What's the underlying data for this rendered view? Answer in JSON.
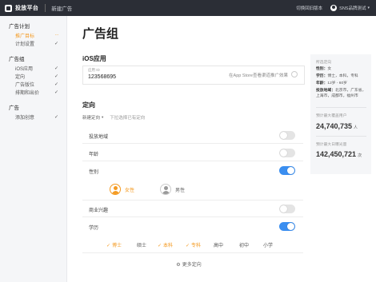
{
  "topbar": {
    "app_name": "投放平台",
    "current_page": "新建广告",
    "help_link": "切换回旧版本",
    "user_name": "SNS品牌测试"
  },
  "sidebar": {
    "groups": [
      {
        "title": "广告计划",
        "items": [
          {
            "label": "推广目标",
            "mark": "···",
            "active": true
          },
          {
            "label": "计划设置",
            "mark": "✓",
            "active": false
          }
        ]
      },
      {
        "title": "广告组",
        "items": [
          {
            "label": "iOS应用",
            "mark": "✓",
            "active": false
          },
          {
            "label": "定向",
            "mark": "✓",
            "active": false
          },
          {
            "label": "广告版位",
            "mark": "✓",
            "active": false
          },
          {
            "label": "排期和出价",
            "mark": "✓",
            "active": false
          }
        ]
      },
      {
        "title": "广告",
        "items": [
          {
            "label": "添加创意",
            "mark": "✓",
            "active": false
          }
        ]
      }
    ]
  },
  "main": {
    "page_title": "广告组",
    "ios_section_title": "iOS应用",
    "app_id_label": "应用 ID",
    "app_id_value": "123568695",
    "app_store_link": "在App Store查看渠道推广效果",
    "targeting_title": "定向",
    "targeting_select": "新建定向",
    "targeting_hint": "下拉选择已有定向",
    "rows": {
      "location": {
        "label": "投放地域",
        "on": false
      },
      "age": {
        "label": "年龄",
        "on": false
      },
      "gender": {
        "label": "性别",
        "on": true
      },
      "interest": {
        "label": "商业兴趣",
        "on": false
      },
      "education": {
        "label": "学历",
        "on": true
      }
    },
    "gender_options": {
      "female": "女性",
      "male": "男性"
    },
    "education_options": {
      "phd": "博士",
      "master": "硕士",
      "bachelor": "本科",
      "associate": "专科",
      "high_school": "高中",
      "middle_school": "初中",
      "primary": "小学"
    },
    "more_targeting": "更多定向"
  },
  "summary": {
    "label_selected": "所选定向",
    "gender_line_key": "性别：",
    "gender_line_val": "女",
    "education_line_key": "学历：",
    "education_line_val": "博士，本科，专科",
    "age_line_key": "年龄：",
    "age_line_val": "12岁 - 60岁",
    "region_line_key": "投放地域：",
    "region_line_val": "北京市，广东省，上海市，成都市，福州市",
    "label_max_users": "预计最大覆盖用户",
    "max_users": "24,740,735",
    "max_users_unit": "人",
    "label_daily_exposure": "预计最大日曝光量",
    "daily_exposure": "142,450,721",
    "daily_exposure_unit": "次"
  },
  "colors": {
    "accent": "#f49a21",
    "toggle_on": "#3a8ef0",
    "topbar": "#2b2e36"
  }
}
